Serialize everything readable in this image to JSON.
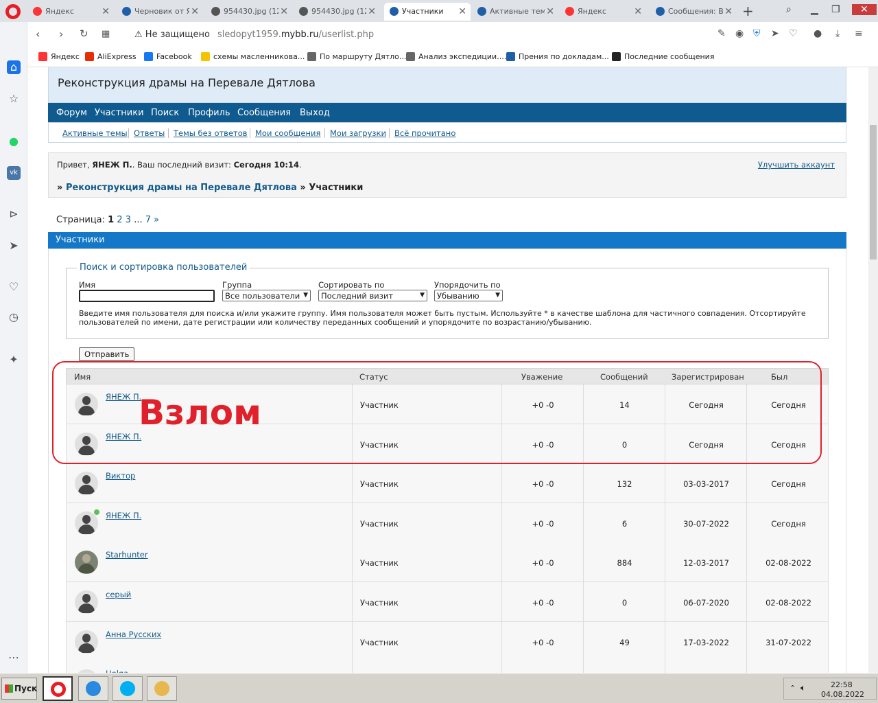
{
  "browser": {
    "tabs": [
      {
        "label": "Яндекс",
        "icon": "yandex-icon",
        "active": false
      },
      {
        "label": "Черновик от Я",
        "icon": "forum-icon",
        "active": false
      },
      {
        "label": "954430.jpg (12",
        "icon": "globe-icon",
        "active": false
      },
      {
        "label": "954430.jpg (12",
        "icon": "globe-icon",
        "active": false
      },
      {
        "label": "Участники",
        "icon": "forum-icon",
        "active": true
      },
      {
        "label": "Активные темы",
        "icon": "forum-icon",
        "active": false
      },
      {
        "label": "Яндекс",
        "icon": "yandex-icon",
        "active": false
      },
      {
        "label": "Сообщения: В",
        "icon": "forum-icon",
        "active": false
      }
    ],
    "address": {
      "warning": "Не защищено",
      "url_prefix": "sledopyt1959.",
      "url_host": "mybb.ru",
      "url_path": "/userlist.php"
    },
    "bookmarks": [
      "Яндекс",
      "AliExpress",
      "Facebook",
      "схемы масленникова...",
      "По маршруту Дятло...",
      "Анализ экспедиции....",
      "Прения по докладам...",
      "Последние сообщения"
    ]
  },
  "board": {
    "title": "Реконструкция драмы на Перевале Дятлова",
    "nav": [
      "Форум",
      "Участники",
      "Поиск",
      "Профиль",
      "Сообщения",
      "Выход"
    ],
    "subnav": [
      "Активные темы",
      "Ответы",
      "Темы без ответов",
      "Мои сообщения",
      "Мои загрузки",
      "Всё прочитано"
    ],
    "welcome": {
      "prefix": "Привет, ",
      "user": "ЯНЕЖ П.",
      "mid": ". Ваш последний визит: ",
      "visit": "Сегодня 10:14",
      "suffix": "."
    },
    "upgrade": "Улучшить аккаунт",
    "crumbs": {
      "sep": "»",
      "home": "Реконструкция драмы на Перевале Дятлова",
      "current": "Участники"
    },
    "pages": {
      "label": "Страница:",
      "current": "1",
      "p2": "2",
      "p3": "3",
      "dots": "...",
      "last": "7",
      "next": "»"
    }
  },
  "userlist": {
    "block_title": "Участники",
    "search": {
      "legend": "Поиск и сортировка пользователей",
      "name_label": "Имя",
      "name_value": "",
      "group_label": "Группа",
      "group_value": "Все пользователи",
      "sort_label": "Сортировать по",
      "sort_value": "Последний визит",
      "order_label": "Упорядочить по",
      "order_value": "Убыванию",
      "hint": "Введите имя пользователя для поиска и/или укажите группу. Имя пользователя может быть пустым. Используйте * в качестве шаблона для частичного совпадения. Отсортируйте пользователей по имени, дате регистрации или количеству переданных сообщений и упорядочите по возрастанию/убыванию.",
      "submit": "Отправить"
    },
    "columns": [
      "Имя",
      "Статус",
      "Уважение",
      "Сообщений",
      "Зарегистрирован",
      "Был"
    ],
    "rows": [
      {
        "name": "ЯНЕЖ П.",
        "status": "Участник",
        "respect": "+0 -0",
        "posts": "14",
        "registered": "Сегодня",
        "last": "Сегодня",
        "avatar": "default",
        "online": false
      },
      {
        "name": "ЯНЕЖ П.",
        "status": "Участник",
        "respect": "+0 -0",
        "posts": "0",
        "registered": "Сегодня",
        "last": "Сегодня",
        "avatar": "default",
        "online": false
      },
      {
        "name": "Виктор",
        "status": "Участник",
        "respect": "+0 -0",
        "posts": "132",
        "registered": "03-03-2017",
        "last": "Сегодня",
        "avatar": "default",
        "online": false
      },
      {
        "name": "ЯНЕЖ П.",
        "status": "Участник",
        "respect": "+0 -0",
        "posts": "6",
        "registered": "30-07-2022",
        "last": "Сегодня",
        "avatar": "default",
        "online": true
      },
      {
        "name": "Starhunter",
        "status": "Участник",
        "respect": "+0 -0",
        "posts": "884",
        "registered": "12-03-2017",
        "last": "02-08-2022",
        "avatar": "photo",
        "online": false
      },
      {
        "name": "серый",
        "status": "Участник",
        "respect": "+0 -0",
        "posts": "0",
        "registered": "06-07-2020",
        "last": "02-08-2022",
        "avatar": "default",
        "online": false
      },
      {
        "name": "Анна Русских",
        "status": "Участник",
        "respect": "+0 -0",
        "posts": "49",
        "registered": "17-03-2022",
        "last": "31-07-2022",
        "avatar": "default",
        "online": false
      },
      {
        "name": "Helga",
        "status": "",
        "respect": "",
        "posts": "",
        "registered": "",
        "last": "",
        "avatar": "default",
        "online": false
      }
    ]
  },
  "annotation": {
    "label": "Взлом",
    "color": "#e0202a"
  },
  "taskbar": {
    "start": "Пуск",
    "time": "22:58",
    "date": "04.08.2022"
  },
  "colors": {
    "nav": "#0f5a8f",
    "block_head": "#1477c7",
    "header_bg": "#dfebf6",
    "link": "#135a8a"
  }
}
